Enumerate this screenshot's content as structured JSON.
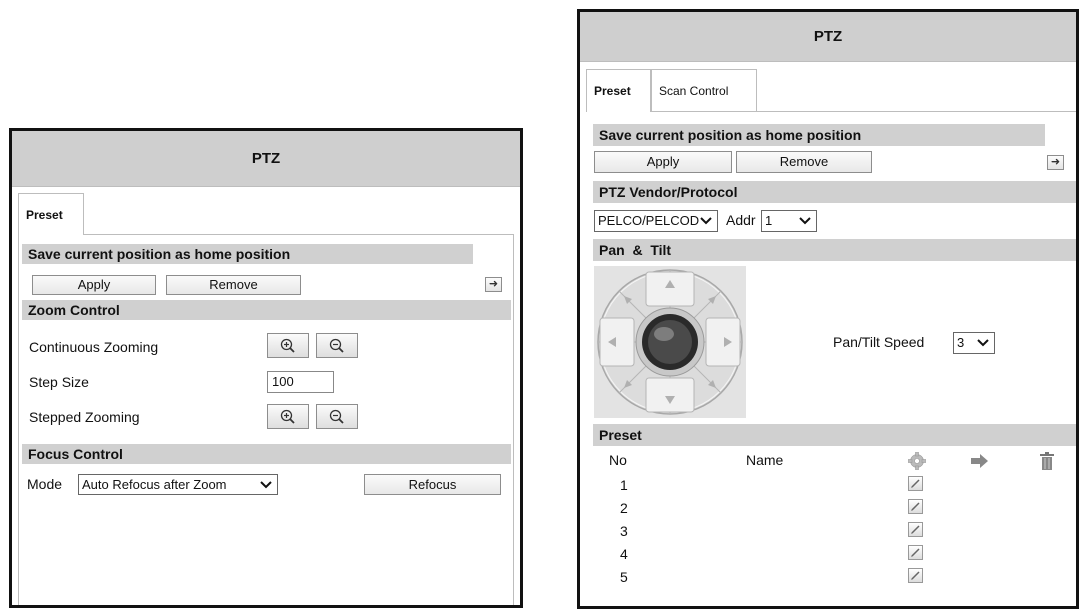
{
  "left": {
    "title": "PTZ",
    "tabs": [
      {
        "label": "Preset"
      }
    ],
    "home_section": "Save current position as home position",
    "apply_label": "Apply",
    "remove_label": "Remove",
    "zoom_section": "Zoom Control",
    "continuous_label": "Continuous Zooming",
    "step_size_label": "Step Size",
    "step_size_value": "100",
    "stepped_label": "Stepped Zooming",
    "focus_section": "Focus Control",
    "mode_label": "Mode",
    "mode_value": "Auto Refocus after Zoom",
    "refocus_label": "Refocus"
  },
  "right": {
    "title": "PTZ",
    "tabs": [
      {
        "label": "Preset"
      },
      {
        "label": "Scan Control"
      }
    ],
    "home_section": "Save current position as home position",
    "apply_label": "Apply",
    "remove_label": "Remove",
    "vendor_section": "PTZ Vendor/Protocol",
    "vendor_value": "PELCO/PELCOD",
    "addr_label": "Addr",
    "addr_value": "1",
    "pantilt_section": "Pan  &  Tilt",
    "speed_label": "Pan/Tilt Speed",
    "speed_value": "3",
    "preset_section": "Preset",
    "col_no": "No",
    "col_name": "Name",
    "rows": [
      {
        "no": "1"
      },
      {
        "no": "2"
      },
      {
        "no": "3"
      },
      {
        "no": "4"
      },
      {
        "no": "5"
      }
    ]
  },
  "icons": {
    "zoom_in": "zoom-in-icon",
    "zoom_out": "zoom-out-icon",
    "arrow": "arrow-right-icon",
    "settings": "gear-icon",
    "goto": "goto-arrow-icon",
    "delete": "trash-icon",
    "edit": "edit-pencil-icon"
  }
}
